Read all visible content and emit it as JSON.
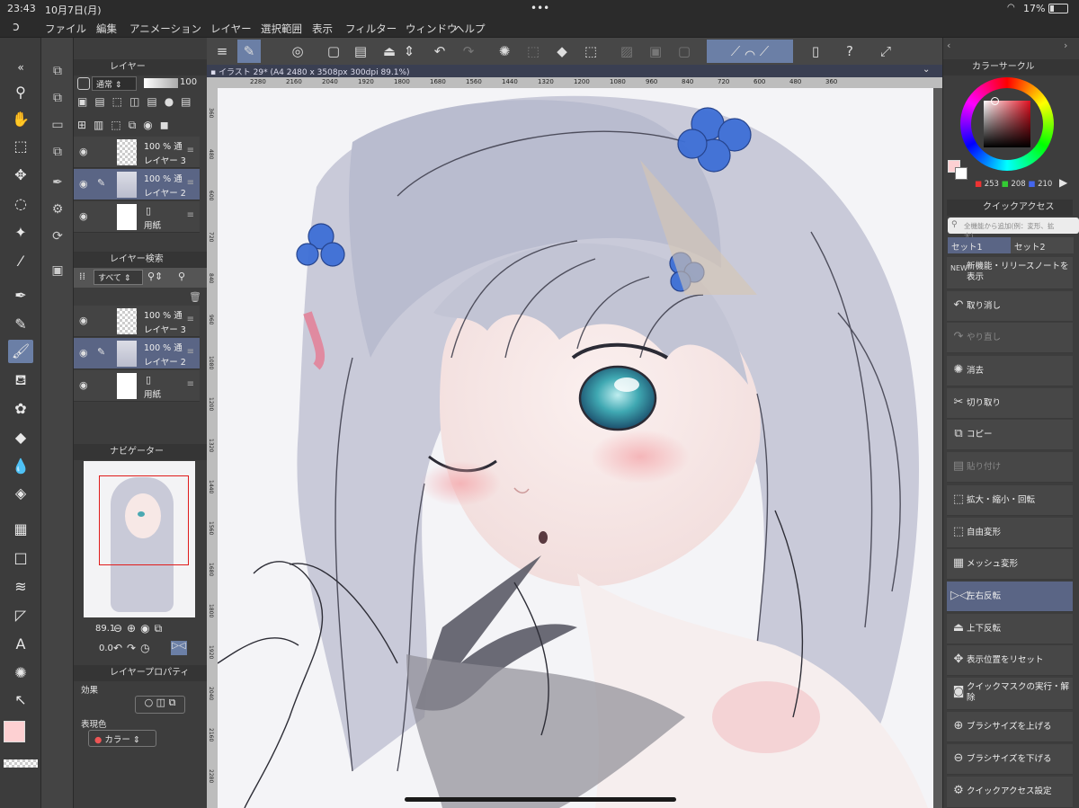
{
  "status": {
    "time": "23:43",
    "date": "10月7日(月)",
    "dots": "•••",
    "wifi": "wifi-icon",
    "battery": "17%"
  },
  "menu": {
    "logo": "clip-studio-logo",
    "items": [
      "ファイル",
      "編集",
      "アニメーション",
      "レイヤー",
      "選択範囲",
      "表示",
      "フィルター",
      "ウィンドウ",
      "ヘルプ"
    ]
  },
  "canvas_tab": {
    "label": "イラスト 29* (A4 2480 x 3508px 300dpi 89.1%)"
  },
  "ruler": {
    "h_ticks": [
      "2280",
      "2160",
      "2040",
      "1920",
      "1800",
      "1680",
      "1560",
      "1440",
      "1320",
      "1200",
      "1080",
      "960",
      "840",
      "720",
      "600",
      "480",
      "360"
    ],
    "v_ticks": [
      "360",
      "480",
      "600",
      "720",
      "840",
      "960",
      "1080",
      "1200",
      "1320",
      "1440",
      "1560",
      "1680",
      "1800",
      "1920",
      "2040",
      "2160",
      "2280"
    ]
  },
  "layer_panel": {
    "title": "レイヤー",
    "blend": "通常",
    "opacity": "100",
    "layers": [
      {
        "opacity": "100 %",
        "mode": "通",
        "name": "レイヤー 3",
        "selected": false
      },
      {
        "opacity": "100 %",
        "mode": "通",
        "name": "レイヤー 2",
        "selected": true
      },
      {
        "opacity": "",
        "mode": "",
        "name": "用紙",
        "selected": false
      }
    ]
  },
  "layer_search": {
    "title": "レイヤー検索",
    "filter": "すべて",
    "layers": [
      {
        "opacity": "100 %",
        "mode": "通",
        "name": "レイヤー 3",
        "selected": false
      },
      {
        "opacity": "100 %",
        "mode": "通",
        "name": "レイヤー 2",
        "selected": true
      },
      {
        "opacity": "",
        "mode": "",
        "name": "用紙",
        "selected": false
      }
    ]
  },
  "navigator": {
    "title": "ナビゲーター",
    "zoom": "89.1",
    "angle": "0.0"
  },
  "layer_property": {
    "title": "レイヤープロパティ",
    "effect_label": "効果",
    "color_label": "表現色",
    "color_value": "カラー"
  },
  "color_circle": {
    "title": "カラーサークル",
    "r": "253",
    "g": "208",
    "b": "210",
    "main_color": "#fdd0d2"
  },
  "quick_access": {
    "title": "クイックアクセス",
    "search_placeholder": "全機能から追加(例：変形、拡大)",
    "sets": [
      "セット1",
      "セット2"
    ],
    "items": [
      {
        "icon": "new-icon",
        "label": "新機能・リリースノートを表示"
      },
      {
        "icon": "undo-icon",
        "label": "取り消し"
      },
      {
        "icon": "redo-icon",
        "label": "やり直し"
      },
      {
        "icon": "clear-icon",
        "label": "消去"
      },
      {
        "icon": "cut-icon",
        "label": "切り取り"
      },
      {
        "icon": "copy-icon",
        "label": "コピー"
      },
      {
        "icon": "paste-icon",
        "label": "貼り付け"
      },
      {
        "icon": "scale-rotate-icon",
        "label": "拡大・縮小・回転"
      },
      {
        "icon": "free-transform-icon",
        "label": "自由変形"
      },
      {
        "icon": "mesh-transform-icon",
        "label": "メッシュ変形"
      },
      {
        "icon": "flip-horizontal-icon",
        "label": "左右反転"
      },
      {
        "icon": "flip-vertical-icon",
        "label": "上下反転"
      },
      {
        "icon": "reset-view-icon",
        "label": "表示位置をリセット"
      },
      {
        "icon": "quick-mask-icon",
        "label": "クイックマスクの実行・解除"
      },
      {
        "icon": "brush-size-up-icon",
        "label": "ブラシサイズを上げる"
      },
      {
        "icon": "brush-size-down-icon",
        "label": "ブラシサイズを下げる"
      },
      {
        "icon": "quick-access-settings-icon",
        "label": "クイックアクセス設定"
      }
    ]
  }
}
